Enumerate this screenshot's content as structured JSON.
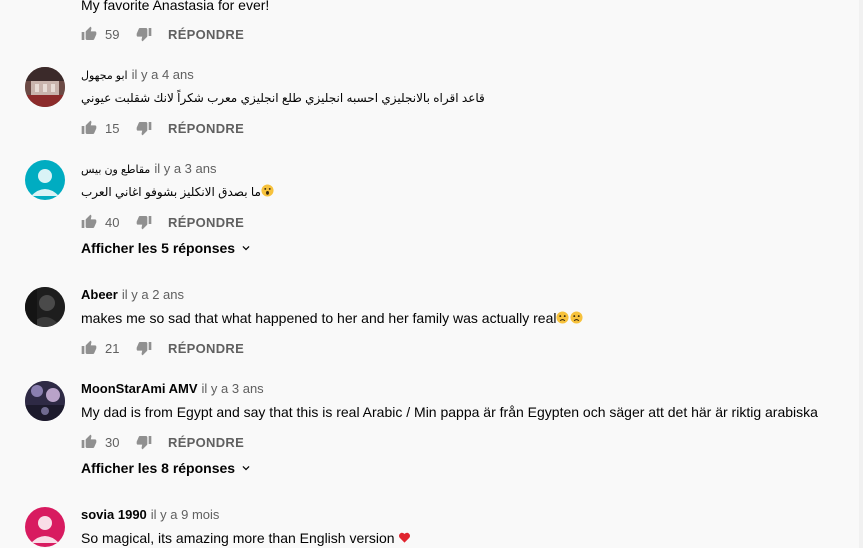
{
  "comments": [
    {
      "text": "My favorite Anastasia for ever!",
      "likes": "59",
      "reply_label": "RÉPONDRE"
    },
    {
      "author": "ابو مجهول",
      "time": "il y a 4 ans",
      "text": "قاعد اقراه بالانجليزي احسبه انجليزي طلع انجليزي معرب شكراً لانك شقلبت عيوني",
      "likes": "15",
      "reply_label": "RÉPONDRE"
    },
    {
      "author": "مقاطع ون بيس",
      "time": "il y a 3 ans",
      "text": "ما بصدق الانكليز بشوفو اغاني العرب",
      "likes": "40",
      "reply_label": "RÉPONDRE",
      "show_replies": "Afficher les 5 réponses"
    },
    {
      "author": "Abeer",
      "time": "il y a 2 ans",
      "text": "makes me so sad that what happened to her and her family was actually real",
      "likes": "21",
      "reply_label": "RÉPONDRE"
    },
    {
      "author": "MoonStarAmi AMV",
      "time": "il y a 3 ans",
      "text": "My dad is from Egypt and say that this is real Arabic / Min pappa är från Egypten och säger att det här är riktig arabiska",
      "likes": "30",
      "reply_label": "RÉPONDRE",
      "show_replies": "Afficher les 8 réponses"
    },
    {
      "author": "sovia 1990",
      "time": "il y a 9 mois",
      "text": "So magical, its amazing more than  English version"
    }
  ],
  "colors": {
    "background": "#f9f9f9",
    "secondary_text": "#606060",
    "avatar_teal": "#00acc1",
    "avatar_pink": "#d81b60",
    "heart": "#e0242e"
  },
  "icons": [
    "thumb-up-icon",
    "thumb-down-icon",
    "chevron-down-icon",
    "default-avatar-icon",
    "heart-emoji",
    "worried-face-emoji",
    "astonished-face-emoji"
  ]
}
